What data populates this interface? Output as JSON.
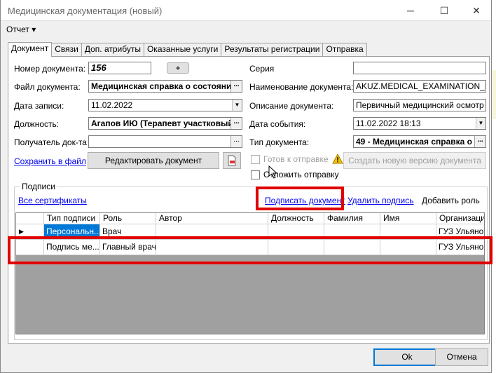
{
  "window": {
    "title": "Медицинская документация (новый)",
    "minimize": "─",
    "maximize": "☐",
    "close": "✕"
  },
  "menu": {
    "report": "Отчет ▾"
  },
  "tabs": [
    "Документ",
    "Связи",
    "Доп. атрибуты",
    "Оказанные услуги",
    "Результаты регистрации",
    "Отправка"
  ],
  "form": {
    "doc_number_label": "Номер документа:",
    "doc_number_value": "156",
    "plus_label": "+",
    "series_label": "Серия",
    "series_value": "",
    "doc_file_label": "Файл документа:",
    "doc_file_value": "Медицинская справка о состоянии",
    "doc_name_label": "Наименование документа:",
    "doc_name_value": "AKUZ.MEDICAL_EXAMINATION_MAIN",
    "record_date_label": "Дата записи:",
    "record_date_value": "11.02.2022",
    "doc_desc_label": "Описание документа:",
    "doc_desc_value": "Первичный медицинский осмотр",
    "position_label": "Должность:",
    "position_value": "Агапов ИЮ (Терапевт участковый)",
    "event_date_label": "Дата события:",
    "event_date_value": "11.02.2022 18:13",
    "recipient_label": "Получатель док-та",
    "recipient_value": "",
    "doc_type_label": "Тип документа:",
    "doc_type_value": "49 - Медицинская справка о",
    "save_file_link": "Сохранить в файл",
    "edit_doc_button": "Редактировать документ",
    "ready_to_send_label": "Готов к отправке",
    "postpone_send_label": "Отложить отправку",
    "new_version_button": "Создать новую версию документа",
    "ellipsis": "..."
  },
  "signatures": {
    "group_title": "Подписи",
    "all_certs_link": "Все сертификаты",
    "sign_doc_link": "Подписать документ",
    "delete_sig_link": "Удалить подпись",
    "add_role_label": "Добавить роль",
    "columns": [
      "",
      "Тип подписи",
      "Роль",
      "Автор",
      "Должность",
      "Фамилия",
      "Имя",
      "Организация"
    ],
    "rows": [
      {
        "marker": "▶",
        "type": "Персональн...",
        "role": "Врач",
        "author": "",
        "position": "",
        "surname": "",
        "name": "",
        "org": "ГУЗ Ульянов"
      },
      {
        "marker": "",
        "type": "Подпись ме...",
        "role": "Главный врач",
        "author": "",
        "position": "",
        "surname": "",
        "name": "",
        "org": "ГУЗ Ульянов"
      }
    ]
  },
  "footer": {
    "ok": "Ok",
    "cancel": "Отмена"
  },
  "colors": {
    "highlight": "#e00000",
    "selection": "#0078d7",
    "link": "#0000ee",
    "grid_empty": "#a0a0a0"
  }
}
